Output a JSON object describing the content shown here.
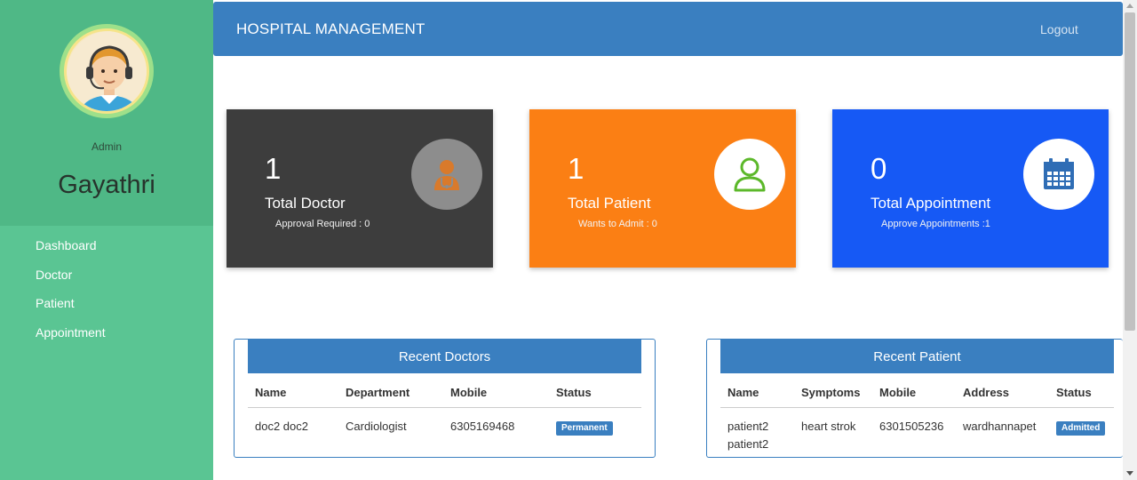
{
  "sidebar": {
    "role": "Admin",
    "username": "Gayathri",
    "nav": [
      "Dashboard",
      "Doctor",
      "Patient",
      "Appointment"
    ]
  },
  "header": {
    "title": "HOSPITAL MANAGEMENT",
    "logout": "Logout"
  },
  "cards": {
    "doctor": {
      "count": "1",
      "label": "Total Doctor",
      "sub": "Approval Required : 0",
      "icon": "doctor-icon",
      "color": "#3d3d3d"
    },
    "patient": {
      "count": "1",
      "label": "Total Patient",
      "sub": "Wants to Admit : 0",
      "icon": "user-icon",
      "color": "#fb7f14"
    },
    "appointment": {
      "count": "0",
      "label": "Total Appointment",
      "sub": "Approve Appointments :1",
      "icon": "calendar-icon",
      "color": "#1659f5"
    }
  },
  "recent_doctors": {
    "title": "Recent Doctors",
    "columns": [
      "Name",
      "Department",
      "Mobile",
      "Status"
    ],
    "rows": [
      {
        "name": "doc2 doc2",
        "department": "Cardiologist",
        "mobile": "6305169468",
        "status": "Permanent"
      }
    ]
  },
  "recent_patients": {
    "title": "Recent Patient",
    "columns": [
      "Name",
      "Symptoms",
      "Mobile",
      "Address",
      "Status"
    ],
    "rows": [
      {
        "name_line1": "patient2",
        "name_line2": "patient2",
        "symptoms": "heart strok",
        "mobile": "6301505236",
        "address": "wardhannapet",
        "status": "Admitted"
      }
    ]
  },
  "colors": {
    "sidebar": "#5ac593",
    "sidebar_top": "#4fb886",
    "header": "#3a7fc0"
  }
}
